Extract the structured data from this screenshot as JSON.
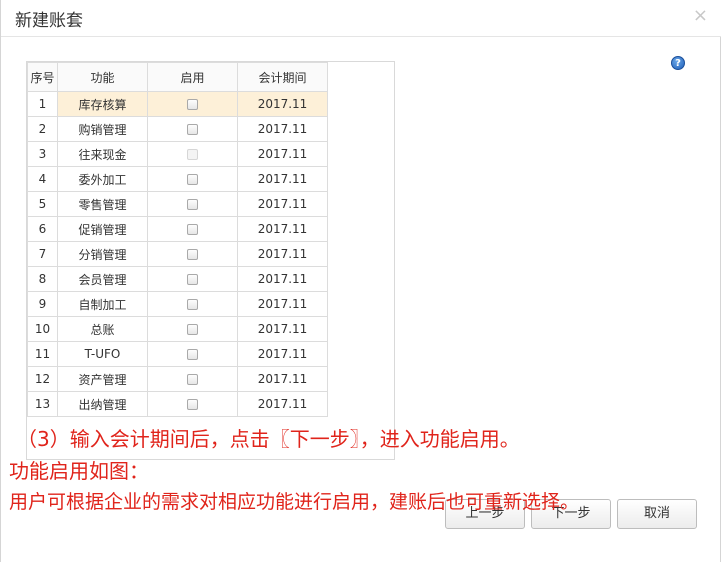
{
  "dialog": {
    "title": "新建账套",
    "close_glyph": "×",
    "help_glyph": "?"
  },
  "grid": {
    "headers": [
      "序号",
      "功能",
      "启用",
      "会计期间"
    ],
    "rows": [
      {
        "no": "1",
        "func": "库存核算",
        "enabled": false,
        "disabled": false,
        "period": "2017.11",
        "selected": true
      },
      {
        "no": "2",
        "func": "购销管理",
        "enabled": false,
        "disabled": false,
        "period": "2017.11"
      },
      {
        "no": "3",
        "func": "往来现金",
        "enabled": false,
        "disabled": true,
        "period": "2017.11"
      },
      {
        "no": "4",
        "func": "委外加工",
        "enabled": false,
        "disabled": false,
        "period": "2017.11"
      },
      {
        "no": "5",
        "func": "零售管理",
        "enabled": false,
        "disabled": false,
        "period": "2017.11"
      },
      {
        "no": "6",
        "func": "促销管理",
        "enabled": false,
        "disabled": false,
        "period": "2017.11"
      },
      {
        "no": "7",
        "func": "分销管理",
        "enabled": false,
        "disabled": false,
        "period": "2017.11"
      },
      {
        "no": "8",
        "func": "会员管理",
        "enabled": false,
        "disabled": false,
        "period": "2017.11"
      },
      {
        "no": "9",
        "func": "自制加工",
        "enabled": false,
        "disabled": false,
        "period": "2017.11"
      },
      {
        "no": "10",
        "func": "总账",
        "enabled": false,
        "disabled": false,
        "period": "2017.11"
      },
      {
        "no": "11",
        "func": "T-UFO",
        "enabled": false,
        "disabled": false,
        "period": "2017.11"
      },
      {
        "no": "12",
        "func": "资产管理",
        "enabled": false,
        "disabled": false,
        "period": "2017.11"
      },
      {
        "no": "13",
        "func": "出纳管理",
        "enabled": false,
        "disabled": false,
        "period": "2017.11"
      }
    ]
  },
  "buttons": {
    "prev": "上一步",
    "next": "下一步",
    "cancel": "取消"
  },
  "annotations": {
    "line1": "（3）输入会计期间后，点击〖下一步〗，进入功能启用。",
    "line2": "功能启用如图：",
    "line3": "用户可根据企业的需求对相应功能进行启用，建账后也可重新选择。"
  },
  "colors": {
    "annotation": "#e0241b",
    "selected_row": "#fdf0d8",
    "help_icon": "#1f5fb8"
  }
}
